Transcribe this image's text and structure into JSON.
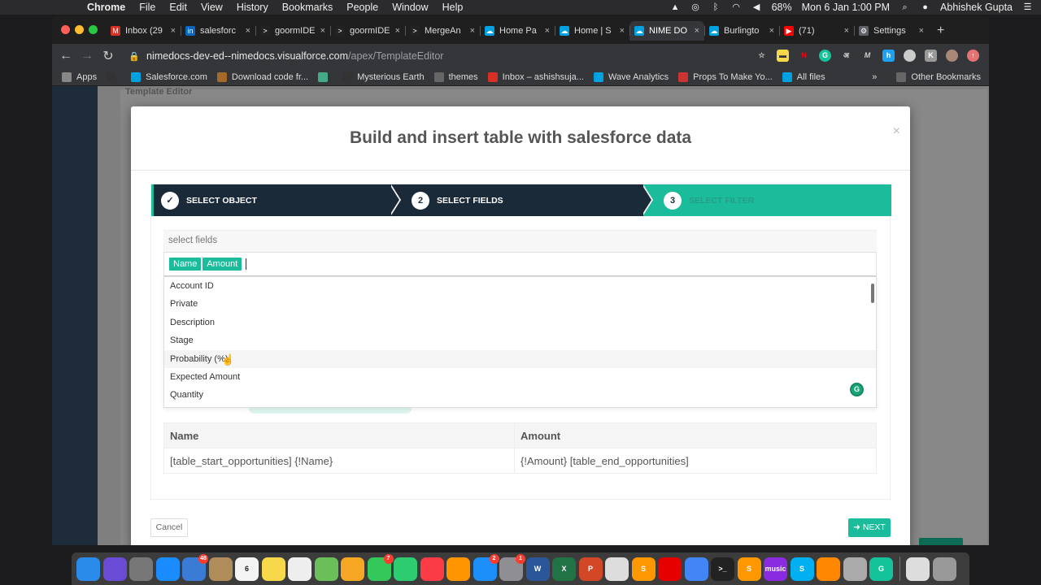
{
  "menubar": {
    "app": "Chrome",
    "items": [
      "File",
      "Edit",
      "View",
      "History",
      "Bookmarks",
      "People",
      "Window",
      "Help"
    ],
    "battery": "68%",
    "datetime": "Mon 6 Jan  1:00 PM",
    "user": "Abhishek Gupta"
  },
  "tabs": [
    {
      "title": "Inbox (29",
      "icon": "gmail-icon",
      "color": "#d93025",
      "glyph": "M"
    },
    {
      "title": "salesforc",
      "icon": "linkedin-icon",
      "color": "#0a66c2",
      "glyph": "in"
    },
    {
      "title": "goormIDE",
      "icon": "terminal-icon",
      "color": "#222",
      "glyph": ">"
    },
    {
      "title": "goormIDE",
      "icon": "terminal-icon",
      "color": "#222",
      "glyph": ">"
    },
    {
      "title": "MergeAn",
      "icon": "terminal-icon",
      "color": "#222",
      "glyph": ">"
    },
    {
      "title": "Home Pa",
      "icon": "salesforce-icon",
      "color": "#00a1e0",
      "glyph": "☁"
    },
    {
      "title": "Home | S",
      "icon": "salesforce-icon",
      "color": "#00a1e0",
      "glyph": "☁"
    },
    {
      "title": "NIME DO",
      "icon": "salesforce-icon",
      "color": "#00a1e0",
      "glyph": "☁",
      "active": true
    },
    {
      "title": "Burlingto",
      "icon": "salesforce-icon",
      "color": "#00a1e0",
      "glyph": "☁"
    },
    {
      "title": "(71) ",
      "icon": "youtube-icon",
      "color": "#ff0000",
      "glyph": "▶"
    },
    {
      "title": "Settings",
      "icon": "gear-icon",
      "color": "#5f6368",
      "glyph": "⚙"
    }
  ],
  "url": {
    "host": "nimedocs-dev-ed--nimedocs.visualforce.com",
    "path": "/apex/TemplateEditor"
  },
  "bookmarks": [
    {
      "label": "Apps",
      "icon": "apps-icon",
      "color": "#888"
    },
    {
      "label": "",
      "icon": "github-icon",
      "color": "#333"
    },
    {
      "label": "Salesforce.com",
      "icon": "salesforce-icon",
      "color": "#00a1e0"
    },
    {
      "label": "Download code fr...",
      "icon": "download-icon",
      "color": "#a56a2a"
    },
    {
      "label": "",
      "icon": "grid-icon",
      "color": "#4a8"
    },
    {
      "label": "Mysterious Earth",
      "icon": "github-icon",
      "color": "#333"
    },
    {
      "label": "themes",
      "icon": "folder-icon",
      "color": "#666"
    },
    {
      "label": "Inbox – ashishsuja...",
      "icon": "gmail-icon",
      "color": "#d93025"
    },
    {
      "label": "Wave Analytics",
      "icon": "salesforce-icon",
      "color": "#00a1e0"
    },
    {
      "label": "Props To Make Yo...",
      "icon": "bookmark-icon",
      "color": "#c33"
    },
    {
      "label": "All files",
      "icon": "cloud-icon",
      "color": "#00a1e0"
    }
  ],
  "bookmarks_more": "»",
  "other_bookmarks": "Other Bookmarks",
  "page_bg": {
    "title": "Template Editor"
  },
  "modal": {
    "title": "Build and insert table with salesforce data",
    "close": "×",
    "steps": [
      {
        "num": "✓",
        "label": "SELECT OBJECT"
      },
      {
        "num": "2",
        "label": "SELECT FIELDS"
      },
      {
        "num": "3",
        "label": "SELECT FILTER"
      }
    ],
    "select_label": "select fields",
    "chips": [
      "Name",
      "Amount"
    ],
    "options": [
      "Account ID",
      "Private",
      "Description",
      "Stage",
      "Probability (%)",
      "Expected Amount",
      "Quantity"
    ],
    "table": {
      "headers": [
        "Name",
        "Amount"
      ],
      "row": [
        "[table_start_opportunities] {!Name}",
        "{!Amount} [table_end_opportunities]"
      ]
    },
    "cancel": "Cancel",
    "next": "NEXT"
  },
  "dock": [
    {
      "name": "finder-icon",
      "color": "#2a8bea"
    },
    {
      "name": "siri-icon",
      "color": "#6a4bd6"
    },
    {
      "name": "launchpad-icon",
      "color": "#777"
    },
    {
      "name": "safari-icon",
      "color": "#1a8cff"
    },
    {
      "name": "mail-icon",
      "color": "#3a7bd5",
      "badge": "48"
    },
    {
      "name": "contacts-icon",
      "color": "#b08c5a"
    },
    {
      "name": "calendar-icon",
      "color": "#f4f4f4",
      "text": "6"
    },
    {
      "name": "notes-icon",
      "color": "#f7d84a"
    },
    {
      "name": "reminders-icon",
      "color": "#eee"
    },
    {
      "name": "maps-icon",
      "color": "#6bbf59"
    },
    {
      "name": "photos-icon",
      "color": "#f5a623"
    },
    {
      "name": "messages-icon",
      "color": "#34c759",
      "badge": "7"
    },
    {
      "name": "facetime-icon",
      "color": "#2ecc71"
    },
    {
      "name": "music-icon",
      "color": "#fc3c44"
    },
    {
      "name": "books-icon",
      "color": "#ff9500"
    },
    {
      "name": "appstore-icon",
      "color": "#1c8ef9",
      "badge": "2"
    },
    {
      "name": "settings-icon",
      "color": "#8e8e93",
      "badge": "1"
    },
    {
      "name": "word-icon",
      "color": "#2b579a",
      "text": "W"
    },
    {
      "name": "excel-icon",
      "color": "#217346",
      "text": "X"
    },
    {
      "name": "powerpoint-icon",
      "color": "#d24726",
      "text": "P"
    },
    {
      "name": "textedit-icon",
      "color": "#ddd"
    },
    {
      "name": "sublime-icon",
      "color": "#ff9800",
      "text": "S"
    },
    {
      "name": "vodafone-icon",
      "color": "#e60000"
    },
    {
      "name": "chrome-icon",
      "color": "#4285f4"
    },
    {
      "name": "terminal-icon",
      "color": "#222",
      "text": ">_"
    },
    {
      "name": "sublime-icon",
      "color": "#ff9800",
      "text": "S"
    },
    {
      "name": "amazon-music-icon",
      "color": "#8a2be2",
      "text": "music"
    },
    {
      "name": "skype-icon",
      "color": "#00aff0",
      "text": "S"
    },
    {
      "name": "vlc-icon",
      "color": "#ff8800"
    },
    {
      "name": "preview-icon",
      "color": "#aaa"
    },
    {
      "name": "grammarly-icon",
      "color": "#15c39a",
      "text": "G"
    },
    {
      "name": "downloads-icon",
      "color": "#ddd"
    },
    {
      "name": "trash-icon",
      "color": "#999"
    }
  ]
}
